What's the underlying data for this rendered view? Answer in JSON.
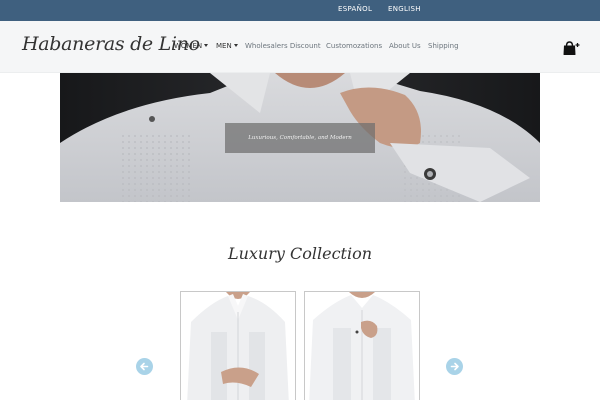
{
  "topbar": {
    "languages": [
      "ESPAÑOL",
      "ENGLISH"
    ]
  },
  "brand": {
    "logo_text": "Habaneras de Lino"
  },
  "nav": {
    "women": "WOMEN",
    "men": "MEN",
    "wholesalers": "Wholesalers Discount",
    "customizations": "Customozations",
    "about": "About Us",
    "shipping": "Shipping"
  },
  "hero": {
    "caption": "Luxurious, Comfortable, and Modern"
  },
  "collection": {
    "title": "Luxury Collection"
  },
  "icons": {
    "cart": "shopping-bag-plus-icon",
    "prev": "arrow-left-circle-icon",
    "next": "arrow-right-circle-icon",
    "dropdown": "caret-down-icon"
  },
  "colors": {
    "topbar": "#3f607f",
    "navbar": "#f5f6f7",
    "arrow": "#a9d3e8"
  }
}
